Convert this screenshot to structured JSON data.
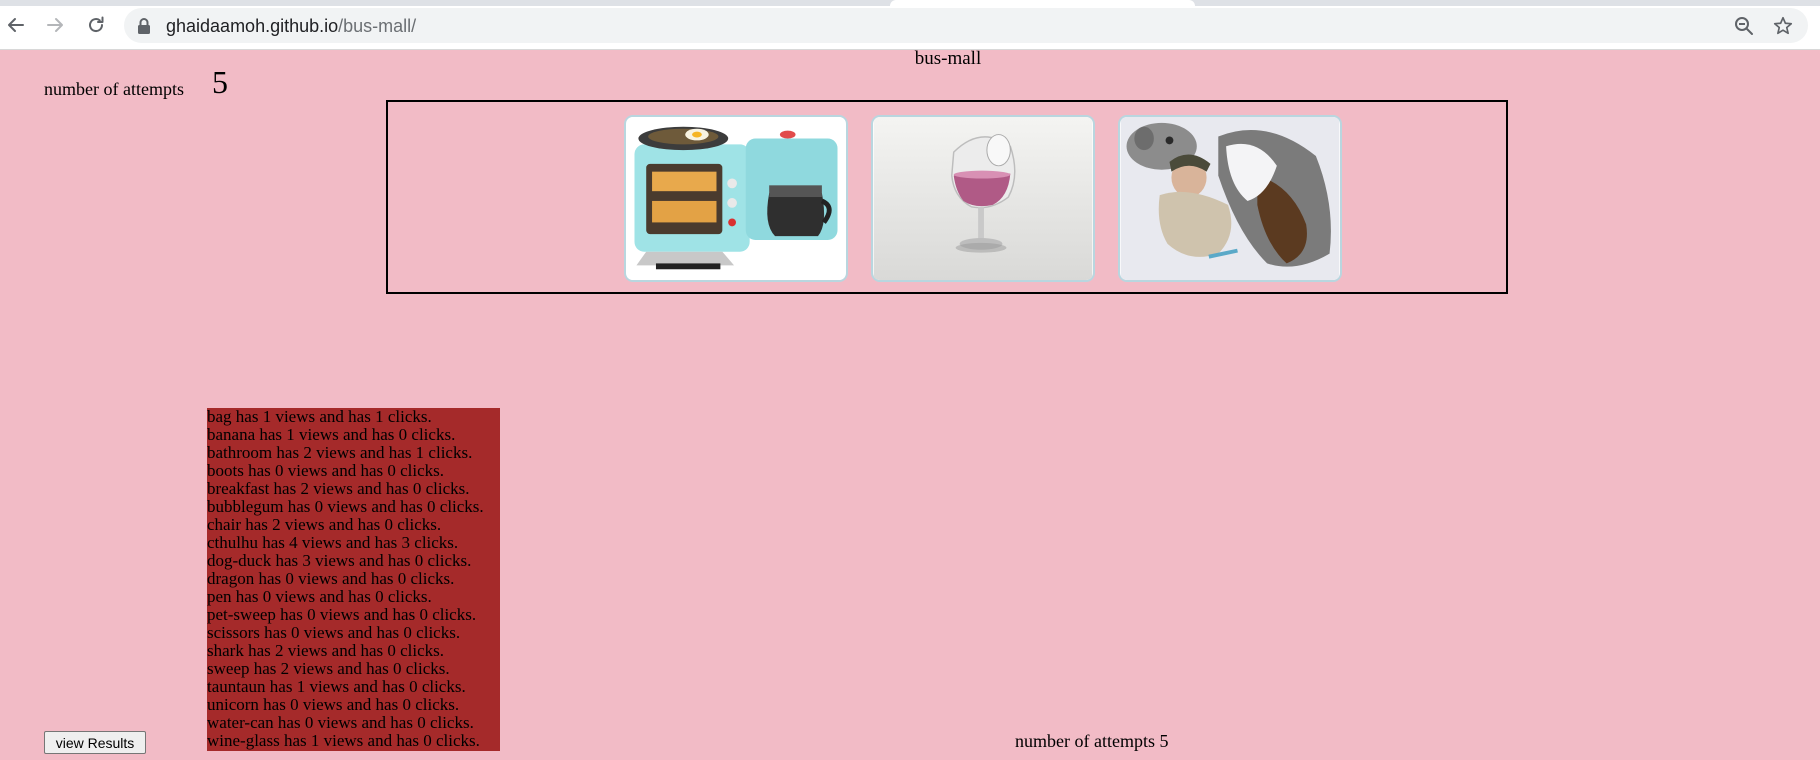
{
  "browser": {
    "url_host": "ghaidaamoh.github.io",
    "url_path": "/bus-mall/",
    "icons": [
      "back-arrow-icon",
      "forward-arrow-icon",
      "reload-icon",
      "lock-icon",
      "zoom-out-icon",
      "star-icon"
    ]
  },
  "page": {
    "title": "bus-mall",
    "attempts_label": "number of attempts",
    "attempts_count": "5",
    "images": [
      {
        "name": "breakfast"
      },
      {
        "name": "wine-glass"
      },
      {
        "name": "tauntaun"
      }
    ],
    "results": [
      "bag has 1 views and has 1 clicks.",
      "banana has 1 views and has 0 clicks.",
      "bathroom has 2 views and has 1 clicks.",
      "boots has 0 views and has 0 clicks.",
      "breakfast has 2 views and has 0 clicks.",
      "bubblegum has 0 views and has 0 clicks.",
      "chair has 2 views and has 0 clicks.",
      "cthulhu has 4 views and has 3 clicks.",
      "dog-duck has 3 views and has 0 clicks.",
      "dragon has 0 views and has 0 clicks.",
      "pen has 0 views and has 0 clicks.",
      "pet-sweep has 0 views and has 0 clicks.",
      "scissors has 0 views and has 0 clicks.",
      "shark has 2 views and has 0 clicks.",
      "sweep has 2 views and has 0 clicks.",
      "tauntaun has 1 views and has 0 clicks.",
      "unicorn has 0 views and has 0 clicks.",
      "water-can has 0 views and has 0 clicks.",
      "wine-glass has 1 views and has 0 clicks."
    ],
    "view_results_label": "view Results",
    "footer_attempts": "number of attempts 5"
  },
  "colors": {
    "page_background": "#f2bbc6",
    "results_background": "#a52a2a"
  }
}
